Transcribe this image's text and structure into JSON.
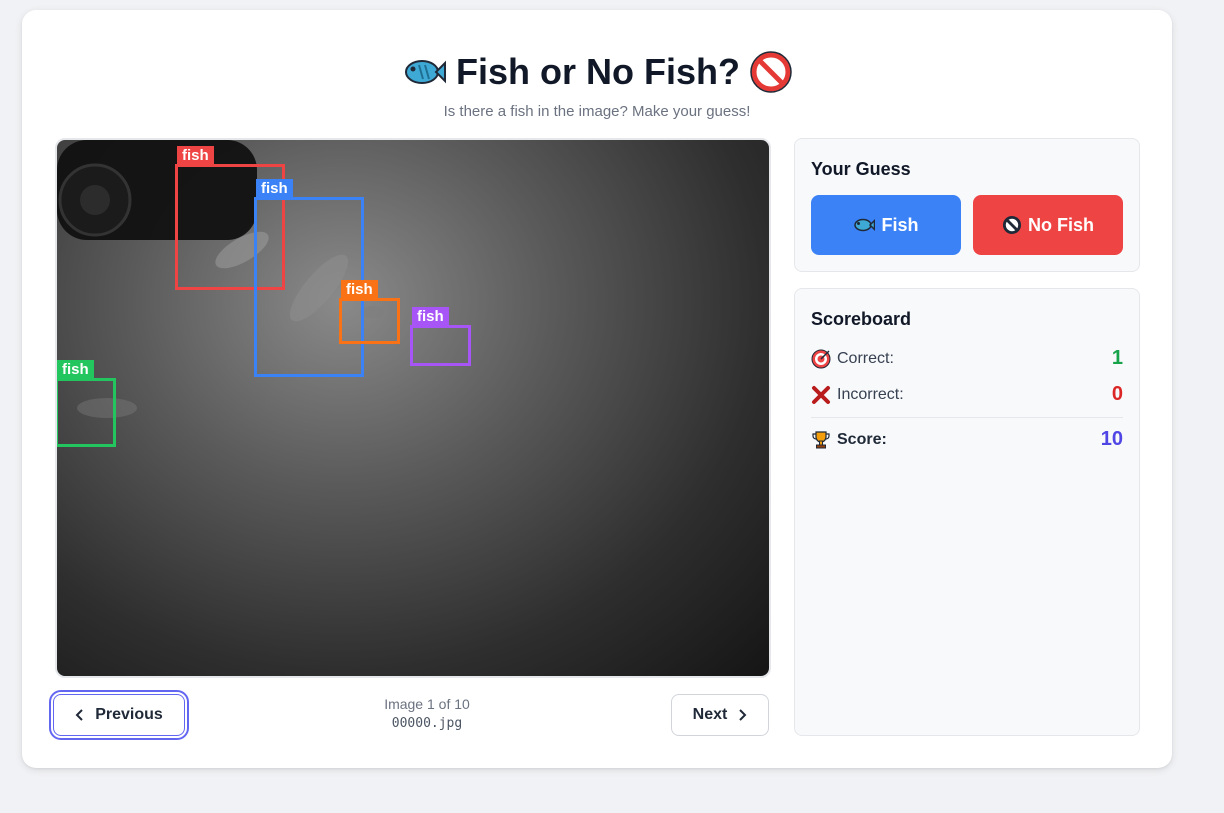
{
  "header": {
    "title": "Fish or No Fish?",
    "title_icon_left": "fish-icon",
    "title_icon_right": "prohibited-icon",
    "subtitle": "Is there a fish in the image? Make your guess!"
  },
  "image_viewer": {
    "detections": [
      {
        "label": "fish",
        "color": "#ef4444"
      },
      {
        "label": "fish",
        "color": "#3b82f6"
      },
      {
        "label": "fish",
        "color": "#f97316"
      },
      {
        "label": "fish",
        "color": "#a855f7"
      },
      {
        "label": "fish",
        "color": "#22c55e"
      }
    ],
    "counter": "Image 1 of 10",
    "filename": "00000.jpg"
  },
  "navigation": {
    "previous_label": "Previous",
    "next_label": "Next"
  },
  "guess": {
    "title": "Your Guess",
    "fish_label": "Fish",
    "no_fish_label": "No Fish",
    "fish_color": "#3b82f6",
    "no_fish_color": "#ef4444"
  },
  "scoreboard": {
    "title": "Scoreboard",
    "correct_label": "Correct:",
    "correct_value": "1",
    "correct_color": "#16a34a",
    "incorrect_label": "Incorrect:",
    "incorrect_value": "0",
    "incorrect_color": "#dc2626",
    "score_label": "Score:",
    "score_value": "10",
    "score_color": "#4f46e5"
  }
}
